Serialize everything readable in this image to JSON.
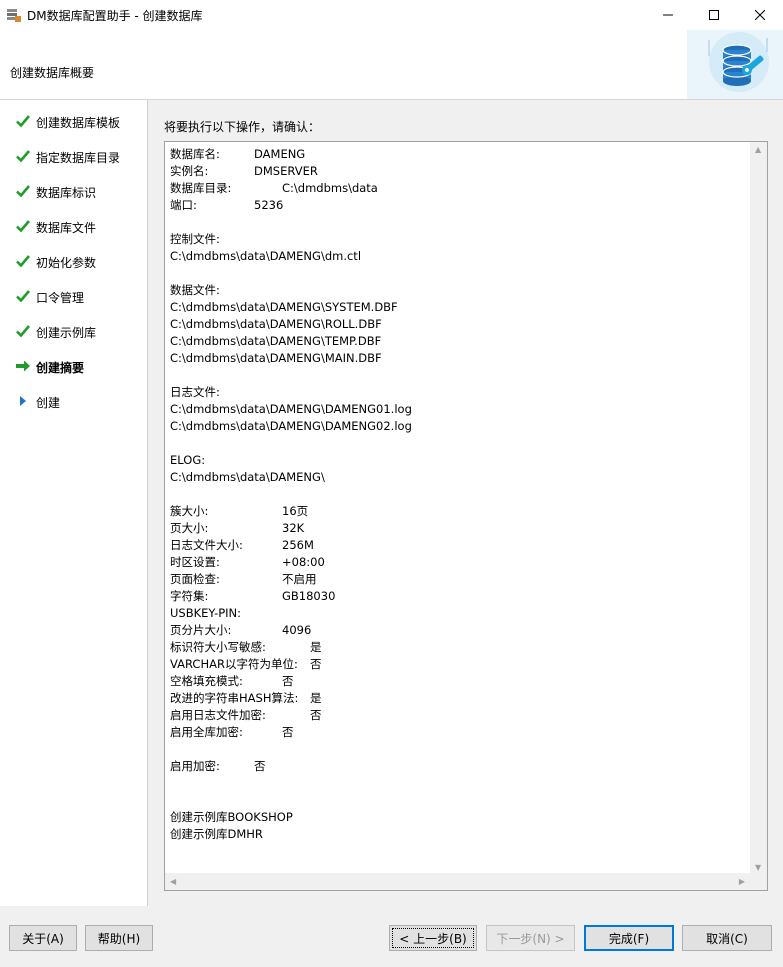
{
  "window": {
    "title": "DM数据库配置助手 - 创建数据库",
    "minimize_glyph": "—",
    "maximize_glyph": "☐",
    "close_glyph": "✕"
  },
  "header": {
    "title": "创建数据库概要",
    "logo_icon": "database-settings-icon"
  },
  "steps": [
    {
      "label": "创建数据库模板",
      "state": "done"
    },
    {
      "label": "指定数据库目录",
      "state": "done"
    },
    {
      "label": "数据库标识",
      "state": "done"
    },
    {
      "label": "数据库文件",
      "state": "done"
    },
    {
      "label": "初始化参数",
      "state": "done"
    },
    {
      "label": "口令管理",
      "state": "done"
    },
    {
      "label": "创建示例库",
      "state": "done"
    },
    {
      "label": "创建摘要",
      "state": "current"
    },
    {
      "label": "创建",
      "state": "pending"
    }
  ],
  "content": {
    "prompt": "将要执行以下操作，请确认：",
    "summary": {
      "db_name_key": "数据库名:",
      "db_name": "DAMENG",
      "instance_key": "实例名:",
      "instance": "DMSERVER",
      "db_dir_key": "数据库目录:",
      "db_dir": "C:\\dmdbms\\data",
      "port_key": "端口:",
      "port": "5236",
      "control_file_header": "控制文件:",
      "control_file": "C:\\dmdbms\\data\\DAMENG\\dm.ctl",
      "data_files_header": "数据文件:",
      "data_files": [
        "C:\\dmdbms\\data\\DAMENG\\SYSTEM.DBF",
        "C:\\dmdbms\\data\\DAMENG\\ROLL.DBF",
        "C:\\dmdbms\\data\\DAMENG\\TEMP.DBF",
        "C:\\dmdbms\\data\\DAMENG\\MAIN.DBF"
      ],
      "log_files_header": "日志文件:",
      "log_files": [
        "C:\\dmdbms\\data\\DAMENG\\DAMENG01.log",
        "C:\\dmdbms\\data\\DAMENG\\DAMENG02.log"
      ],
      "elog_header": "ELOG:",
      "elog": "C:\\dmdbms\\data\\DAMENG\\",
      "params": [
        {
          "key": "簇大小:",
          "value": "16页"
        },
        {
          "key": "页大小:",
          "value": "32K"
        },
        {
          "key": "日志文件大小:",
          "value": "256M"
        },
        {
          "key": "时区设置:",
          "value": "+08:00"
        },
        {
          "key": "页面检查:",
          "value": "不启用"
        },
        {
          "key": "字符集:",
          "value": "GB18030"
        },
        {
          "key": "USBKEY-PIN:",
          "value": ""
        },
        {
          "key": "页分片大小:",
          "value": "4096"
        },
        {
          "key": "标识符大小写敏感:",
          "value": "是"
        },
        {
          "key": "VARCHAR以字符为单位:",
          "value": "否"
        },
        {
          "key": "空格填充模式:",
          "value": "否"
        },
        {
          "key": "改进的字符串HASH算法:",
          "value": "是"
        },
        {
          "key": "启用日志文件加密:",
          "value": "否"
        },
        {
          "key": "启用全库加密:",
          "value": "否"
        }
      ],
      "encrypt_key": "启用加密:",
      "encrypt": "否",
      "sample_dbs": [
        "创建示例库BOOKSHOP",
        "创建示例库DMHR"
      ]
    }
  },
  "buttons": {
    "about": "关于(A)",
    "help": "帮助(H)",
    "back": "< 上一步(B)",
    "next": "下一步(N) >",
    "finish": "完成(F)",
    "cancel": "取消(C)"
  },
  "colors": {
    "check_green": "#1f9d2a",
    "arrow_green": "#1f9d2a",
    "pending_blue": "#1e73c8",
    "focus_blue": "#0078d7"
  }
}
